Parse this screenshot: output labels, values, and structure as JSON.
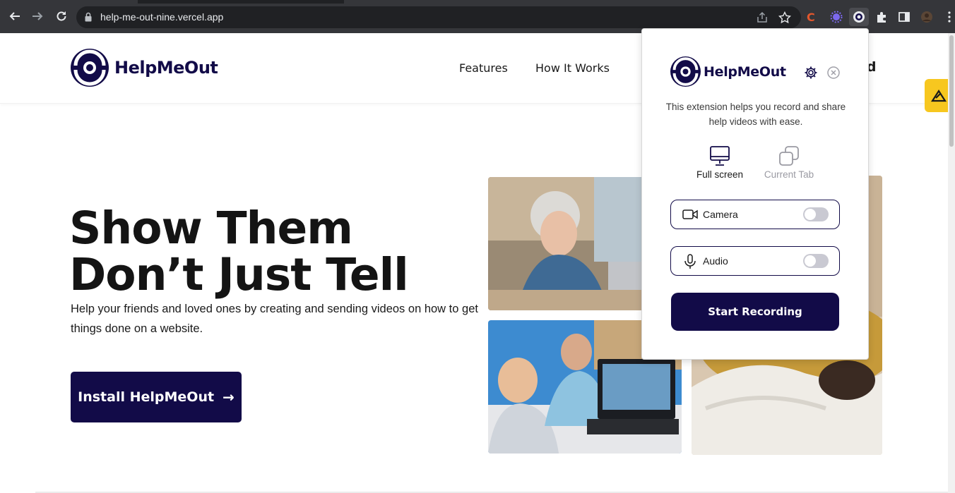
{
  "browser": {
    "url": "help-me-out-nine.vercel.app",
    "back_icon": "arrow-left-icon",
    "forward_icon": "arrow-right-icon",
    "reload_icon": "reload-icon"
  },
  "site": {
    "brand": "HelpMeOut",
    "nav": [
      "Features",
      "How It Works"
    ],
    "nav_cut_text": "ed",
    "hero": {
      "title_line1": "Show Them",
      "title_line2": "Don’t Just Tell",
      "subtitle": "Help your friends and loved ones by creating and sending videos on how to get things done on a website.",
      "install_label": "Install HelpMeOut",
      "install_arrow": "→"
    }
  },
  "popup": {
    "brand": "HelpMeOut",
    "description": "This extension helps you record and share help videos with ease.",
    "modes": [
      {
        "label": "Full screen",
        "icon": "monitor-icon",
        "selected": true
      },
      {
        "label": "Current Tab",
        "icon": "copy-tab-icon",
        "selected": false
      }
    ],
    "toggles": [
      {
        "label": "Camera",
        "icon": "video-camera-icon",
        "on": false
      },
      {
        "label": "Audio",
        "icon": "microphone-icon",
        "on": false
      }
    ],
    "start_label": "Start Recording"
  },
  "colors": {
    "brand": "#120b48",
    "chrome": "#35363a",
    "accent_yellow": "#f7c71f"
  }
}
